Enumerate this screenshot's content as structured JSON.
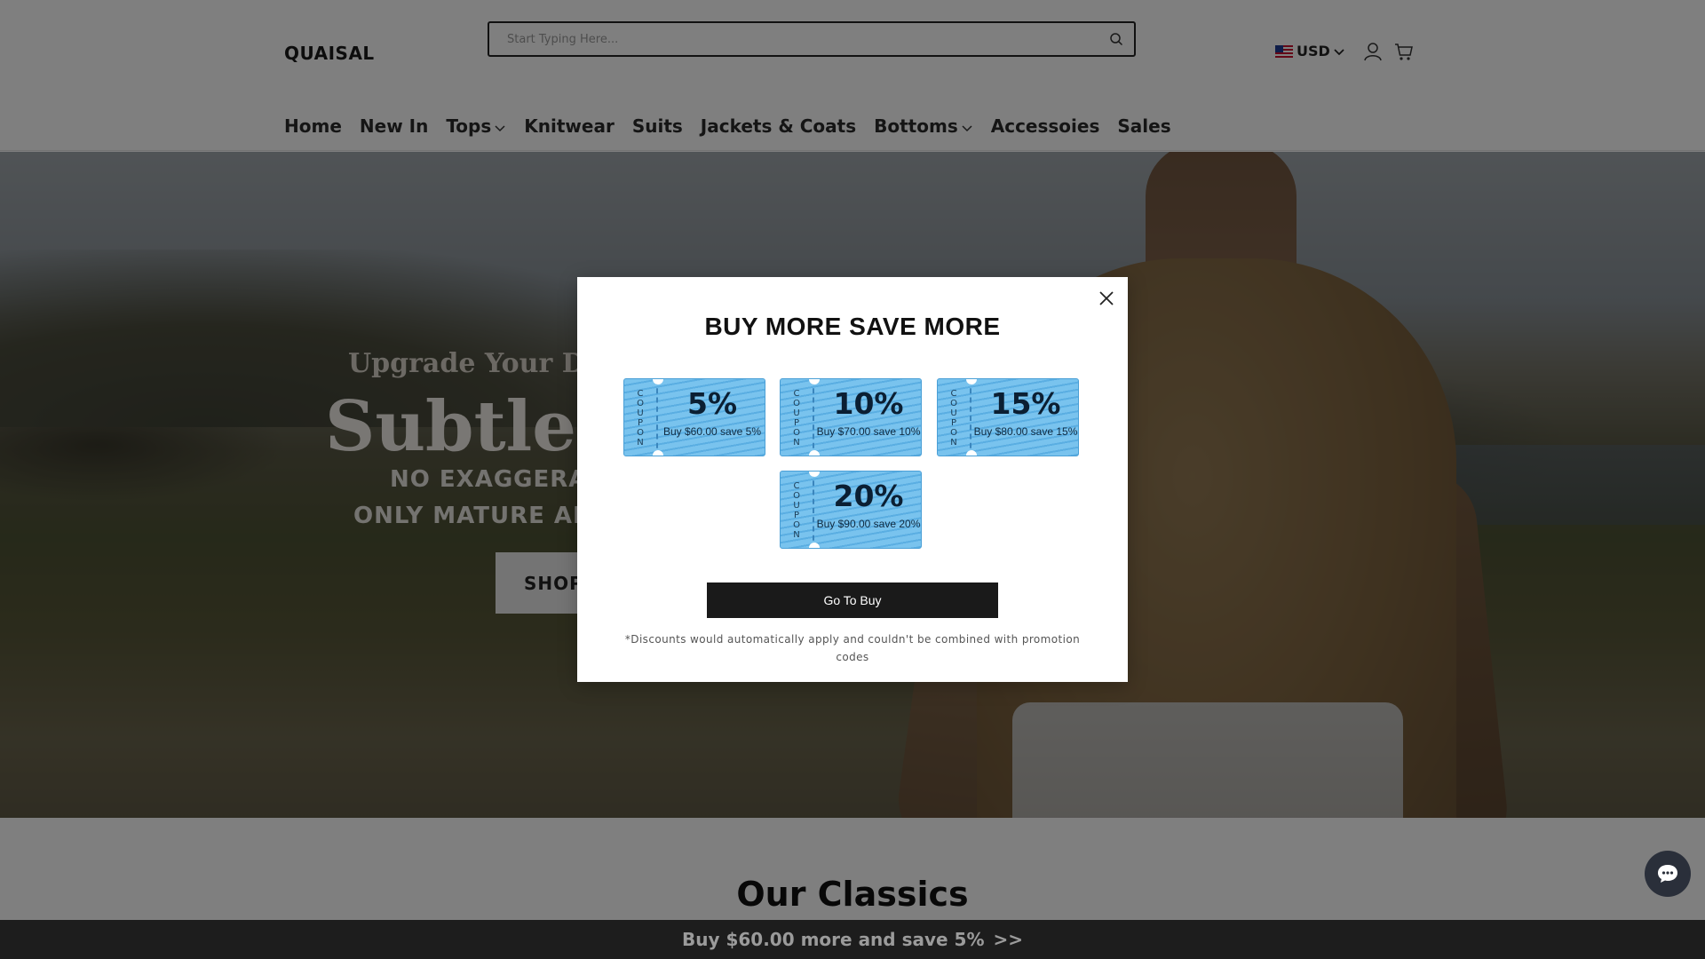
{
  "header": {
    "logo": "QUAISAL",
    "search_placeholder": "Start Typing Here...",
    "currency": "USD",
    "icons": [
      "search-icon",
      "us-flag-icon",
      "chevron-down-icon",
      "user-icon",
      "cart-icon"
    ]
  },
  "nav": {
    "items": [
      {
        "label": "Home",
        "has_dropdown": false
      },
      {
        "label": "New In",
        "has_dropdown": false
      },
      {
        "label": "Tops",
        "has_dropdown": true
      },
      {
        "label": "Knitwear",
        "has_dropdown": false
      },
      {
        "label": "Suits",
        "has_dropdown": false
      },
      {
        "label": "Jackets & Coats",
        "has_dropdown": false
      },
      {
        "label": "Bottoms",
        "has_dropdown": true
      },
      {
        "label": "Accessoies",
        "has_dropdown": false
      },
      {
        "label": "Sales",
        "has_dropdown": false
      }
    ]
  },
  "hero": {
    "pretitle": "Upgrade Your Da",
    "title": "Subtle I",
    "line1": "NO EXAGGERAT",
    "line2": "ONLY MATURE AN",
    "cta": "SHOP"
  },
  "modal": {
    "title": "BUY MORE SAVE MORE",
    "coupon_stub_text": "COUPON",
    "coupons": [
      {
        "percent": "5%",
        "desc": "Buy $60.00 save 5%"
      },
      {
        "percent": "10%",
        "desc": "Buy $70.00 save 10%"
      },
      {
        "percent": "15%",
        "desc": "Buy $80.00 save 15%"
      },
      {
        "percent": "20%",
        "desc": "Buy $90.00 save 20%"
      }
    ],
    "button": "Go To Buy",
    "disclaimer": "*Discounts would automatically apply and couldn't be combined with promotion codes"
  },
  "section_title": "Our Classics",
  "promo_bar": {
    "text": "Buy $60.00 more and save 5%",
    "arrow": ">>"
  },
  "colors": {
    "coupon_blue": "#79c3ee",
    "button_dark": "#1a1a1a",
    "promo_bar_bg": "#1d1d1d"
  }
}
